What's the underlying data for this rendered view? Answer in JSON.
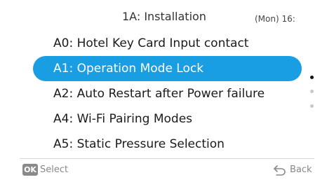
{
  "header": {
    "title": "1A: Installation",
    "clock": "(Mon) 16:"
  },
  "menu": {
    "items": [
      {
        "label": "A0: Hotel Key Card Input contact",
        "selected": false
      },
      {
        "label": "A1: Operation Mode Lock",
        "selected": true
      },
      {
        "label": "A2: Auto Restart after Power failure",
        "selected": false
      },
      {
        "label": "A4: Wi-Fi Pairing Modes",
        "selected": false
      },
      {
        "label": "A5: Static Pressure Selection",
        "selected": false
      }
    ],
    "highlight_color": "#1a9ee3"
  },
  "scroll_indicator": {
    "page_count": 3,
    "active_page": 1
  },
  "footer": {
    "ok_badge": "OK",
    "select_label": "Select",
    "back_label": "Back",
    "back_icon": "return-arrow-icon"
  }
}
